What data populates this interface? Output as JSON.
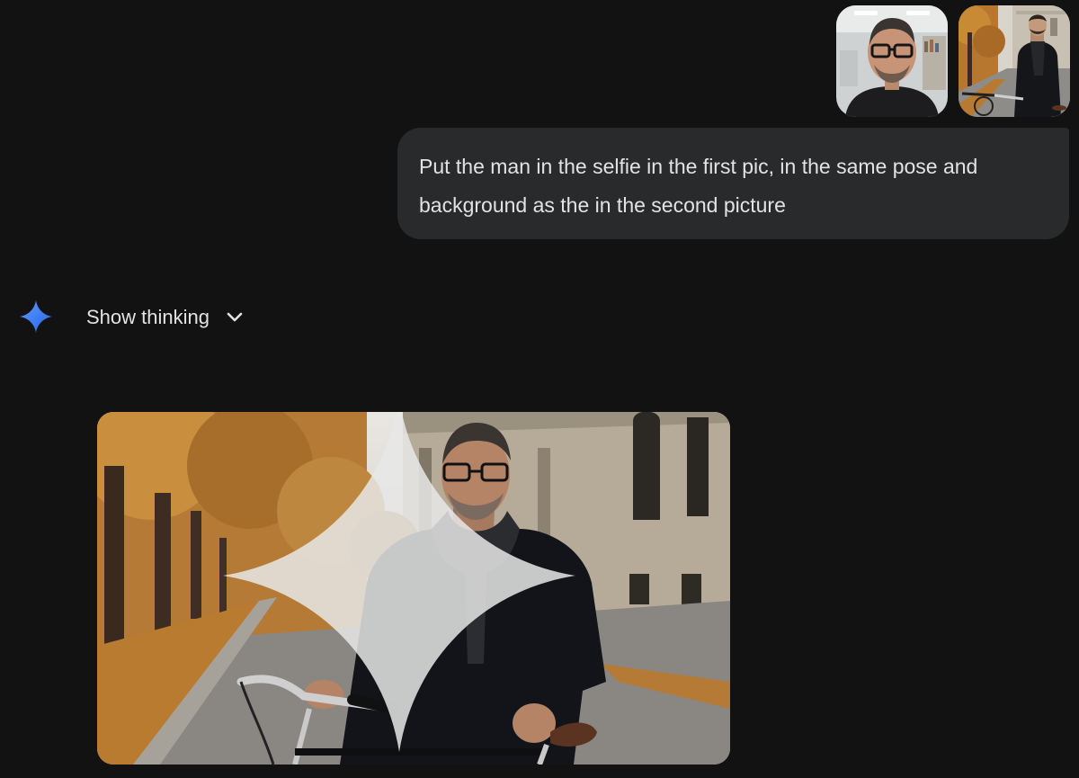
{
  "user_message": {
    "attachments": [
      {
        "icon": "selfie-thumbnail"
      },
      {
        "icon": "reference-photo-thumbnail"
      }
    ],
    "text": "Put the man in the selfie in the first pic, in the same pose and background as the in the second picture"
  },
  "response": {
    "assistant_icon": "gemini-sparkle-icon",
    "thinking_label": "Show thinking",
    "thinking_chevron": "chevron-down-icon",
    "generated_image": {
      "icon": "generated-image",
      "watermark": "sparkle-watermark-icon"
    }
  },
  "colors": {
    "background": "#121212",
    "bubble": "#282a2c",
    "text": "#e3e3e3",
    "accent": "#4c8df6"
  }
}
